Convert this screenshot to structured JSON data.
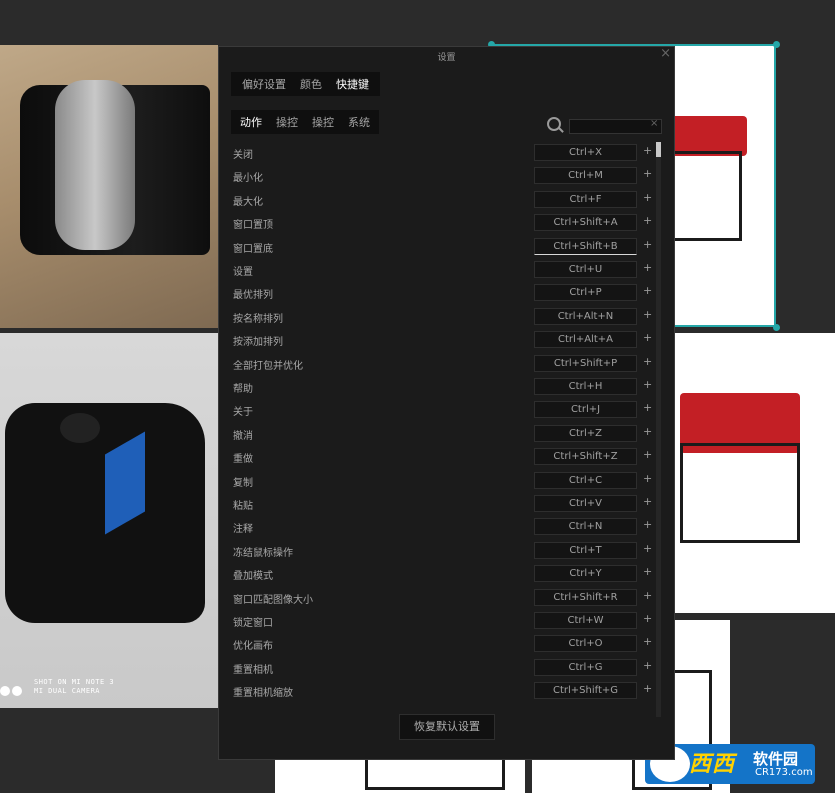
{
  "dialog": {
    "title": "设置",
    "close": "×",
    "tabs": [
      {
        "label": "偏好设置",
        "active": false
      },
      {
        "label": "颜色",
        "active": false
      },
      {
        "label": "快捷键",
        "active": true
      }
    ],
    "subtabs": [
      {
        "label": "动作",
        "active": true
      },
      {
        "label": "操控",
        "active": false
      },
      {
        "label": "操控",
        "active": false
      },
      {
        "label": "系统",
        "active": false
      }
    ],
    "search": {
      "value": "",
      "placeholder": "",
      "clear": "×"
    },
    "shortcuts": [
      {
        "label": "关闭",
        "key": "Ctrl+X"
      },
      {
        "label": "最小化",
        "key": "Ctrl+M"
      },
      {
        "label": "最大化",
        "key": "Ctrl+F"
      },
      {
        "label": "窗口置顶",
        "key": "Ctrl+Shift+A"
      },
      {
        "label": "窗口置底",
        "key": "Ctrl+Shift+B"
      },
      {
        "label": "设置",
        "key": "Ctrl+U"
      },
      {
        "label": "最优排列",
        "key": "Ctrl+P"
      },
      {
        "label": "按名称排列",
        "key": "Ctrl+Alt+N"
      },
      {
        "label": "按添加排列",
        "key": "Ctrl+Alt+A"
      },
      {
        "label": "全部打包并优化",
        "key": "Ctrl+Shift+P"
      },
      {
        "label": "帮助",
        "key": "Ctrl+H"
      },
      {
        "label": "关于",
        "key": "Ctrl+J"
      },
      {
        "label": "撤消",
        "key": "Ctrl+Z"
      },
      {
        "label": "重做",
        "key": "Ctrl+Shift+Z"
      },
      {
        "label": "复制",
        "key": "Ctrl+C"
      },
      {
        "label": "粘贴",
        "key": "Ctrl+V"
      },
      {
        "label": "注释",
        "key": "Ctrl+N"
      },
      {
        "label": "冻结鼠标操作",
        "key": "Ctrl+T"
      },
      {
        "label": "叠加模式",
        "key": "Ctrl+Y"
      },
      {
        "label": "窗口匹配图像大小",
        "key": "Ctrl+Shift+R"
      },
      {
        "label": "锁定窗口",
        "key": "Ctrl+W"
      },
      {
        "label": "优化画布",
        "key": "Ctrl+O"
      },
      {
        "label": "重置相机",
        "key": "Ctrl+G"
      },
      {
        "label": "重置相机缩放",
        "key": "Ctrl+Shift+G"
      }
    ],
    "add_symbol": "+",
    "reset_label": "恢复默认设置"
  },
  "photo_text": {
    "camera_line1": "SHOT ON MI NOTE 3",
    "camera_line2": "MI DUAL CAMERA"
  },
  "watermark": {
    "site_name": "西西",
    "site_suffix": "软件园",
    "domain": "CR173.com"
  },
  "colors": {
    "background": "#2b2b2b",
    "dialog": "#1b1b1b",
    "selection": "#25a7a8",
    "generator_red": "#c31f25"
  }
}
